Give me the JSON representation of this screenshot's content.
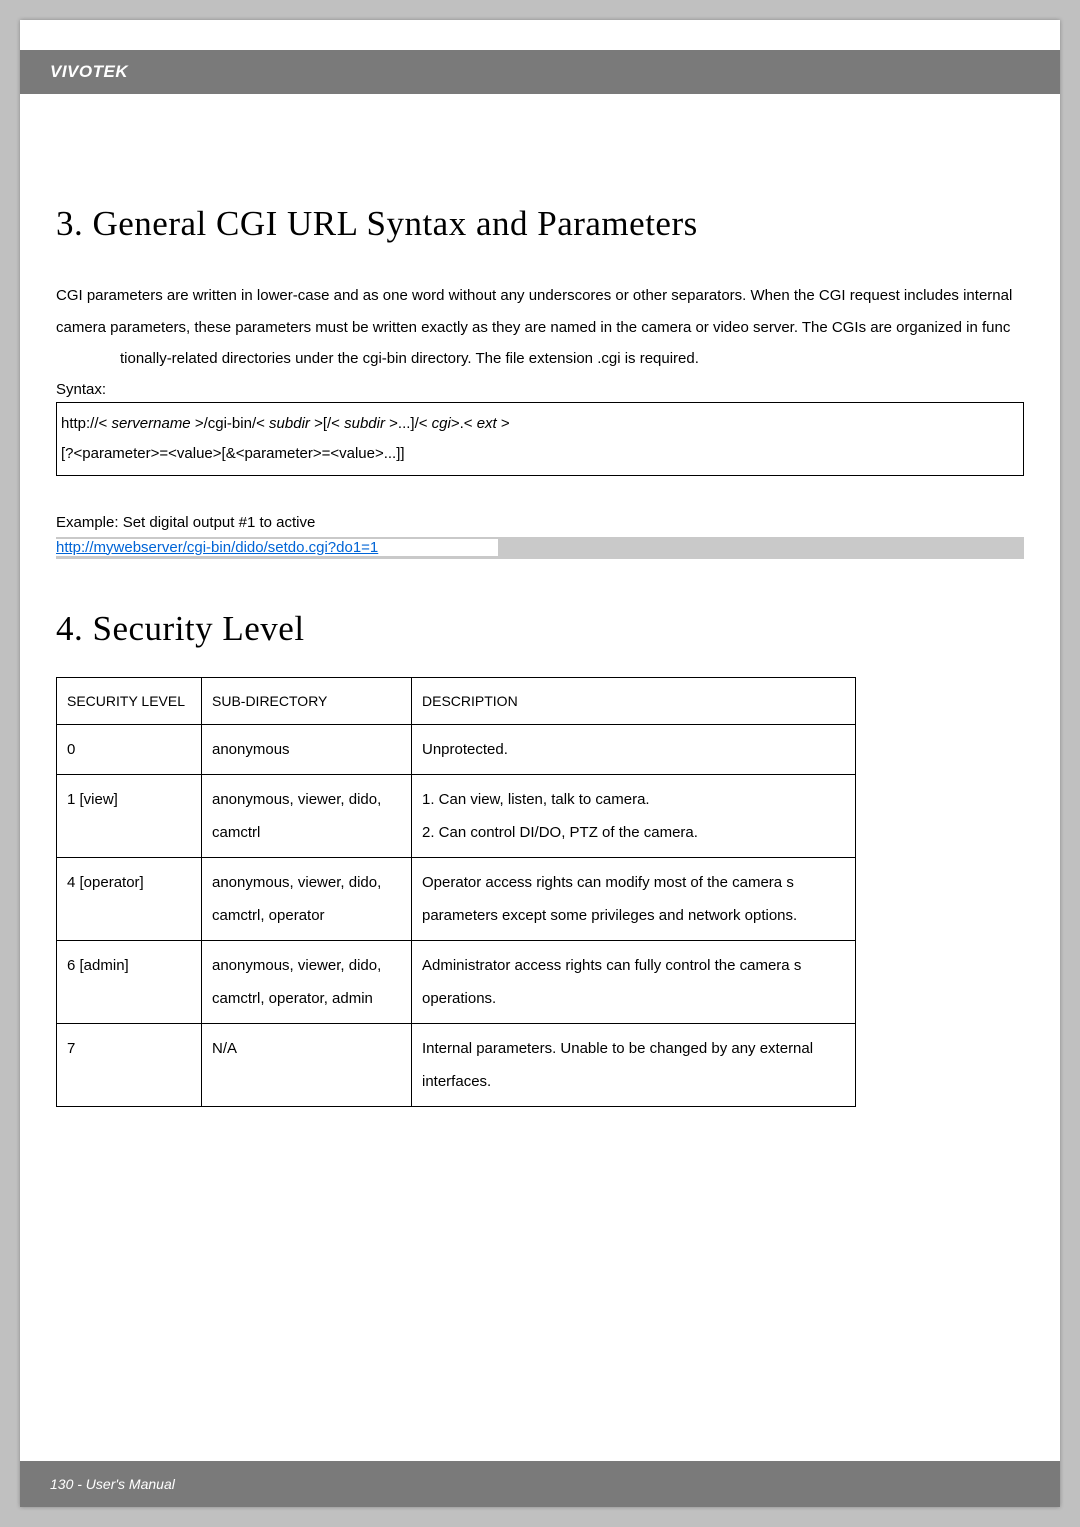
{
  "header": {
    "brand": "VIVOTEK"
  },
  "footer": {
    "text": "130 - User's Manual"
  },
  "section3": {
    "title": "3. General CGI URL Syntax and Parameters",
    "paragraph_part1": "CGI parameters are written in lower-case and as one word without any underscores or other separators. When the CGI request includes internal camera parameters, these parameters must be written exactly as they are named in the camera or video server. The CGIs are organized in func",
    "paragraph_part2": "tionally-related directories under the cgi-bin directory. The file extension .cgi is required.",
    "syntax_label": "Syntax:",
    "syntax_line1_plain1": "http://<   ",
    "syntax_line1_italic1": "servername",
    "syntax_line1_plain2": "  >/cgi-bin/<   ",
    "syntax_line1_italic2": "subdir",
    "syntax_line1_plain3": "  >[/<  ",
    "syntax_line1_italic3": "subdir",
    "syntax_line1_plain4": "  >...]/<   ",
    "syntax_line1_italic4": "cgi",
    "syntax_line1_plain5": ">.<  ",
    "syntax_line1_italic5": "ext",
    "syntax_line1_plain6": " >",
    "syntax_line2": "[?<parameter>=<value>[&<parameter>=<value>...]]",
    "example_label": "Example:    Set digital output #1 to active",
    "example_link": "http://mywebserver/cgi-bin/dido/setdo.cgi?do1=1"
  },
  "section4": {
    "title": "4. Security Level",
    "headers": [
      "SECURITY LEVEL",
      "SUB-DIRECTORY",
      "DESCRIPTION"
    ],
    "rows": [
      {
        "level": "0",
        "sub": "anonymous",
        "desc": "Unprotected."
      },
      {
        "level": "1 [view]",
        "sub": "anonymous, viewer, dido, camctrl",
        "desc": "1. Can view, listen, talk to camera.\n2. Can control DI/DO, PTZ of the camera."
      },
      {
        "level": "4 [operator]",
        "sub": "anonymous, viewer, dido, camctrl, operator",
        "desc": "Operator access rights can modify most of the camera s parameters except some privileges and network options."
      },
      {
        "level": "6 [admin]",
        "sub": "anonymous, viewer, dido, camctrl, operator, admin",
        "desc": "Administrator access rights can fully control the camera s operations."
      },
      {
        "level": "7",
        "sub": "N/A",
        "desc": "Internal parameters. Unable to be changed by any external interfaces."
      }
    ]
  }
}
